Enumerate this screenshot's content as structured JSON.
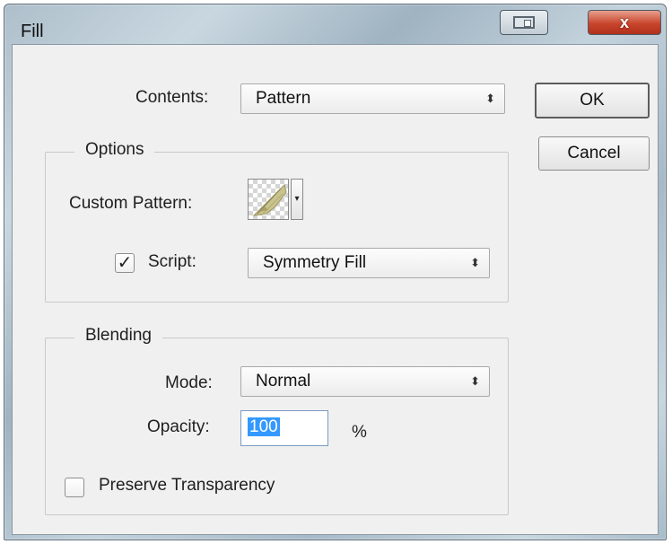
{
  "window": {
    "title": "Fill",
    "close_label": "x"
  },
  "contents": {
    "label": "Contents:",
    "value": "Pattern"
  },
  "buttons": {
    "ok_label": "OK",
    "cancel_label": "Cancel"
  },
  "options": {
    "group_title": "Options",
    "custom_pattern_label": "Custom Pattern:",
    "script_checked": true,
    "script_label": "Script:",
    "script_value": "Symmetry Fill"
  },
  "blending": {
    "group_title": "Blending",
    "mode_label": "Mode:",
    "mode_value": "Normal",
    "opacity_label": "Opacity:",
    "opacity_value": "100",
    "opacity_unit": "%",
    "preserve_transparency_checked": false,
    "preserve_transparency_label": "Preserve Transparency"
  },
  "icons": {
    "checkmark": "✓",
    "dropdown_arrows": "⬍",
    "dropdown_arrow": "▾"
  },
  "colors": {
    "selection": "#3399ff",
    "close_button": "#c9452c"
  }
}
